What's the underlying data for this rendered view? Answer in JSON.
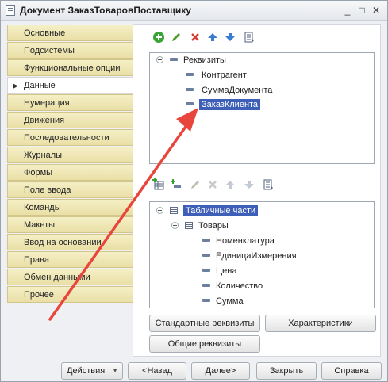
{
  "window": {
    "title": "Документ ЗаказТоваровПоставщику",
    "controls": {
      "minimize": "_",
      "maximize": "□",
      "close": "✕"
    }
  },
  "sidebar": {
    "items": [
      {
        "label": "Основные",
        "active": false
      },
      {
        "label": "Подсистемы",
        "active": false
      },
      {
        "label": "Функциональные опции",
        "active": false
      },
      {
        "label": "Данные",
        "active": true
      },
      {
        "label": "Нумерация",
        "active": false
      },
      {
        "label": "Движения",
        "active": false
      },
      {
        "label": "Последовательности",
        "active": false
      },
      {
        "label": "Журналы",
        "active": false
      },
      {
        "label": "Формы",
        "active": false
      },
      {
        "label": "Поле ввода",
        "active": false
      },
      {
        "label": "Команды",
        "active": false
      },
      {
        "label": "Макеты",
        "active": false
      },
      {
        "label": "Ввод на основании",
        "active": false
      },
      {
        "label": "Права",
        "active": false
      },
      {
        "label": "Обмен данными",
        "active": false
      },
      {
        "label": "Прочее",
        "active": false
      }
    ]
  },
  "attributes_tree": {
    "root": "Реквизиты",
    "items": [
      "Контрагент",
      "СуммаДокумента",
      "ЗаказКлиента"
    ],
    "selected": "ЗаказКлиента"
  },
  "tabular_tree": {
    "root": "Табличные части",
    "table": "Товары",
    "columns": [
      "Номенклатура",
      "ЕдиницаИзмерения",
      "Цена",
      "Количество",
      "Сумма"
    ]
  },
  "panel_buttons": {
    "standard": "Стандартные реквизиты",
    "characteristics": "Характеристики",
    "common": "Общие реквизиты"
  },
  "footer": {
    "actions": "Действия",
    "back": "<Назад",
    "next": "Далее>",
    "close": "Закрыть",
    "help": "Справка"
  },
  "annotation": {
    "arrow_color": "#e8453c"
  }
}
